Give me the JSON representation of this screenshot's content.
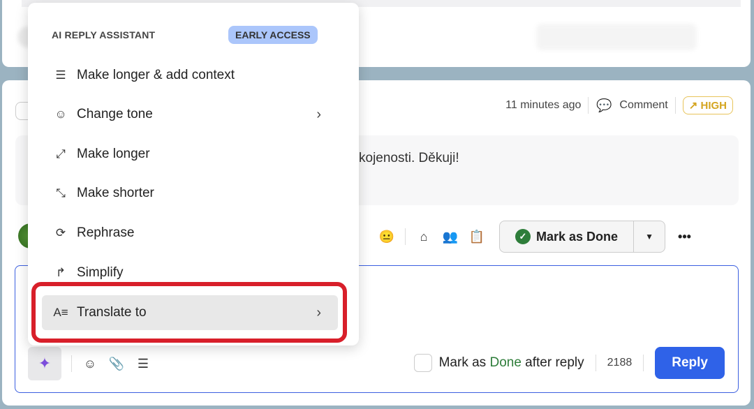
{
  "menu": {
    "header": "AI REPLY ASSISTANT",
    "badge": "EARLY ACCESS",
    "items": [
      {
        "label": "Make longer & add context",
        "icon": "lines-plus-icon"
      },
      {
        "label": "Change tone",
        "icon": "smiley-refresh-icon",
        "submenu": true
      },
      {
        "label": "Make longer",
        "icon": "expand-icon"
      },
      {
        "label": "Make shorter",
        "icon": "collapse-icon"
      },
      {
        "label": "Rephrase",
        "icon": "refresh-icon"
      },
      {
        "label": "Simplify",
        "icon": "simplify-icon"
      },
      {
        "label": "Translate to",
        "icon": "translate-icon",
        "submenu": true,
        "highlighted": true
      }
    ]
  },
  "ticket": {
    "time": "11 minutes ago",
    "comment_label": "Comment",
    "priority": "HIGH",
    "message_fragment": "kojenosti. Děkuji!",
    "mark_done": "Mark as Done"
  },
  "composer": {
    "mark_done_prefix": "Mark as ",
    "mark_done_word": "Done",
    "mark_done_suffix": " after reply",
    "count": "2188",
    "reply": "Reply"
  },
  "colors": {
    "accent": "#2f62e8",
    "done": "#2e7d3a",
    "high": "#d4a520",
    "highlight_ring": "#d81f2a",
    "badge": "#abc6fb"
  }
}
